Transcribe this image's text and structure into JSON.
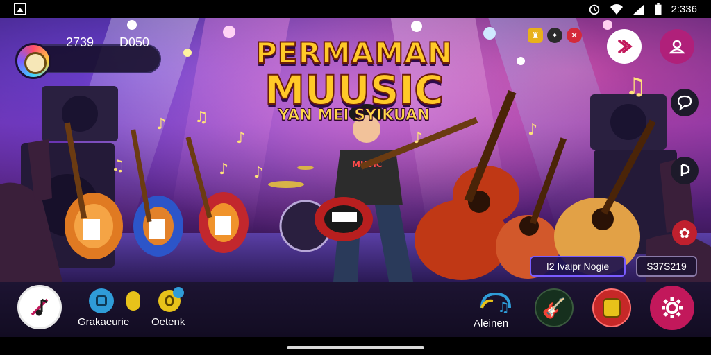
{
  "status_bar": {
    "time": "2:336",
    "icons": [
      "image-icon",
      "alarm-icon",
      "wifi-icon",
      "signal-icon",
      "battery-icon"
    ]
  },
  "hud": {
    "stat_primary": "2739",
    "stat_secondary": "D050"
  },
  "title": {
    "line1": "PERMAMAN",
    "line2": "MUUSIC",
    "line3": "YAN MEI SYIKUAN"
  },
  "top_icons": [
    "badge-icon",
    "mask-icon",
    "tools-icon"
  ],
  "right_side_icons": [
    "share-icon",
    "profile-icon",
    "music-note-icon",
    "chat-icon",
    "tip-icon",
    "settings-gear-small-icon"
  ],
  "stage": {
    "song_label": "I2 Ivaipr Nogie",
    "score": "S37S219"
  },
  "bottom_bar": {
    "item1_label": "Grakaeurie",
    "item2_label": "Oetenk",
    "item3_label": "Aleinen"
  },
  "colors": {
    "title_gold": "#ffc928",
    "accent_magenta": "#c2185b",
    "accent_purple": "#7a5cff"
  }
}
